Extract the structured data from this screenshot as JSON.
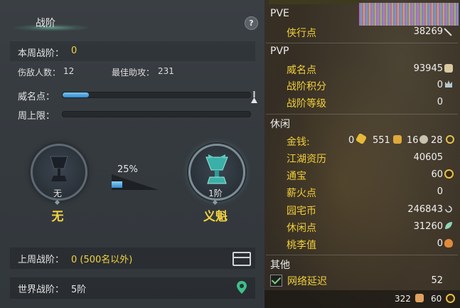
{
  "left_panel": {
    "title": "战阶",
    "help_label": "?",
    "weekly_label": "本周战阶：",
    "weekly_value": "0",
    "kills_label": "伤敌人数：",
    "kills_value": "12",
    "best_assist_label": "最佳助攻：",
    "best_assist_value": "231",
    "prestige_label": "威名点：",
    "prestige_progress": 0.14,
    "weekly_cap_label": "周上限：",
    "weekly_cap_progress": 0,
    "current_rank": {
      "level_text": "无",
      "name": "无"
    },
    "next_rank": {
      "level_text": "1阶",
      "name": "义魁"
    },
    "progress_percent_text": "25%",
    "progress_fraction": 0.25,
    "last_week_label": "上周战阶：",
    "last_week_value": "0 (500名以外)",
    "world_rank_label": "世界战阶：",
    "world_rank_value": "5阶"
  },
  "right_panel": {
    "pve_header": "PVE",
    "pve_items": [
      {
        "label": "侠行点",
        "value": "38269",
        "icon": "quill-icon"
      }
    ],
    "pvp_header": "PVP",
    "pvp_items": [
      {
        "label": "威名点",
        "value": "93945",
        "icon": "prestige-icon"
      },
      {
        "label": "战阶积分",
        "value": "0",
        "icon": "crown-icon"
      },
      {
        "label": "战阶等级",
        "value": "0"
      }
    ],
    "leisure_header": "休闲",
    "money": {
      "label": "金钱:",
      "gold": "0",
      "silver": "551",
      "copper_a": "16",
      "copper_b": "28"
    },
    "leisure_items": [
      {
        "label": "江湖资历",
        "value": "40605"
      },
      {
        "label": "通宝",
        "value": "60",
        "icon": "coin-icon"
      },
      {
        "label": "薪火点",
        "value": "0"
      },
      {
        "label": "园宅币",
        "value": "246843",
        "icon": "spiral-icon"
      },
      {
        "label": "休闲点",
        "value": "31260",
        "icon": "leaf-icon"
      },
      {
        "label": "桃李值",
        "value": "0",
        "icon": "peach-icon"
      }
    ],
    "other_header": "其他",
    "network_label": "网络延迟",
    "network_value": "52",
    "footer_a": "322",
    "footer_b": "60"
  }
}
